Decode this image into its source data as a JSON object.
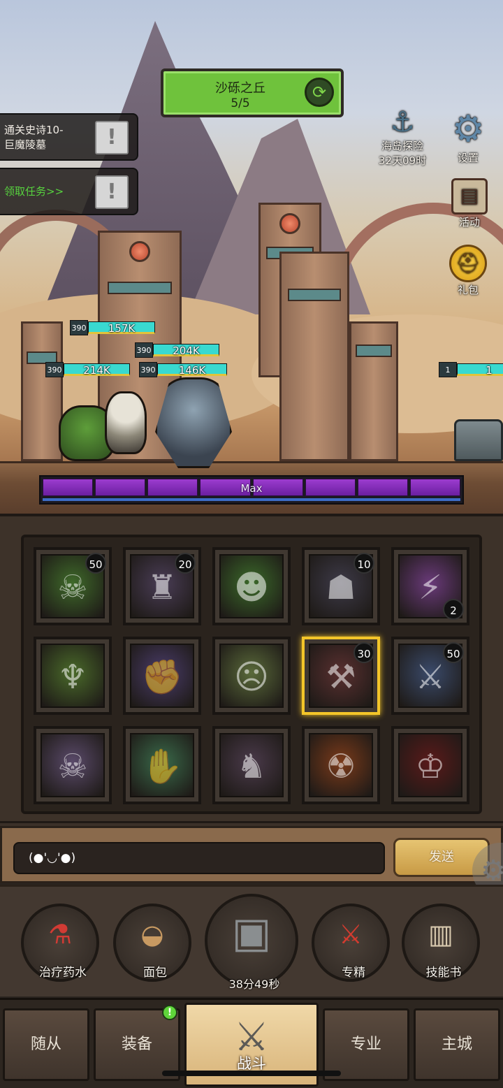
{
  "stage": {
    "name": "沙砾之丘",
    "progress": "5/5",
    "refresh_icon": "refresh-icon"
  },
  "quests": [
    {
      "text": "通关史诗10-\n巨魔陵墓",
      "button_icon": "exclamation-icon"
    },
    {
      "text": "领取任务>>",
      "button_icon": "exclamation-icon",
      "color": "#57d23e"
    }
  ],
  "side_menu": {
    "island": {
      "label": "海岛探险",
      "timer": "32天09时",
      "icon": "anchor-icon"
    },
    "settings": {
      "label": "设置",
      "icon": "gear-icon"
    },
    "activity": {
      "label": "活动",
      "icon": "scroll-icon"
    },
    "gift": {
      "label": "礼包",
      "icon": "coin-icon"
    }
  },
  "party": [
    {
      "level": "390",
      "hp": "157K"
    },
    {
      "level": "390",
      "hp": "204K"
    },
    {
      "level": "390",
      "hp": "214K"
    },
    {
      "level": "390",
      "hp": "146K"
    }
  ],
  "enemy": {
    "level": "1",
    "hp": "1"
  },
  "power_bar": {
    "label": "Max",
    "segments": 8,
    "fill": 1.0
  },
  "skills": [
    {
      "badge": "50",
      "badge_pos": "tr",
      "color": "#3f6a2a",
      "glyph": "☠"
    },
    {
      "badge": "20",
      "badge_pos": "tr",
      "color": "#4a3d56",
      "glyph": "♜"
    },
    {
      "badge": "",
      "badge_pos": "",
      "color": "#3b6a2a",
      "glyph": "☻"
    },
    {
      "badge": "10",
      "badge_pos": "tr",
      "color": "#3d3a48",
      "glyph": "☗"
    },
    {
      "badge": "2",
      "badge_pos": "br",
      "color": "#6a3a7a",
      "glyph": "⚡"
    },
    {
      "badge": "",
      "badge_pos": "",
      "color": "#4a6a2a",
      "glyph": "♆"
    },
    {
      "badge": "",
      "badge_pos": "",
      "color": "#4a3c6a",
      "glyph": "✊"
    },
    {
      "badge": "",
      "badge_pos": "",
      "color": "#5a6a3a",
      "glyph": "☹"
    },
    {
      "badge": "30",
      "badge_pos": "tr",
      "color": "#5a3030",
      "glyph": "⚒",
      "selected": true
    },
    {
      "badge": "50",
      "badge_pos": "tr",
      "color": "#3a4a6a",
      "glyph": "⚔"
    },
    {
      "badge": "",
      "badge_pos": "",
      "color": "#5a4a6a",
      "glyph": "☠"
    },
    {
      "badge": "",
      "badge_pos": "",
      "color": "#3a6a4a",
      "glyph": "✋"
    },
    {
      "badge": "",
      "badge_pos": "",
      "color": "#4a3a4a",
      "glyph": "♞"
    },
    {
      "badge": "",
      "badge_pos": "",
      "color": "#7a3a1a",
      "glyph": "☢"
    },
    {
      "badge": "",
      "badge_pos": "",
      "color": "#5a1a1a",
      "glyph": "♔"
    }
  ],
  "chat": {
    "input_value": "(●'◡'●)",
    "send_label": "发送"
  },
  "actions": {
    "potion": {
      "label": "治疗药水",
      "icon": "potion-icon"
    },
    "bread": {
      "label": "面包",
      "icon": "bread-icon"
    },
    "chest": {
      "label": "38分49秒",
      "icon": "chest-icon"
    },
    "master": {
      "label": "专精",
      "icon": "mastery-icon"
    },
    "book": {
      "label": "技能书",
      "icon": "skillbook-icon"
    }
  },
  "nav": {
    "follower": "随从",
    "equip": "装备",
    "battle": "战斗",
    "pro": "专业",
    "city": "主城",
    "equip_notice": "!"
  }
}
